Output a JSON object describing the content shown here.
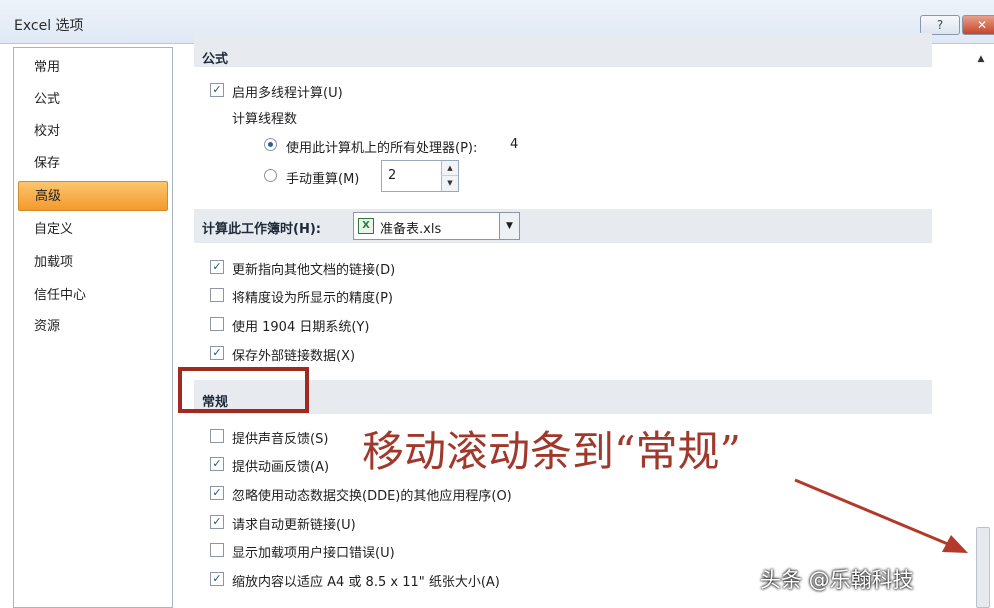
{
  "window": {
    "title": "Excel 选项",
    "help_label": "?",
    "close_label": "✕"
  },
  "sidebar": {
    "items": [
      {
        "label": "常用",
        "active": false
      },
      {
        "label": "公式",
        "active": false
      },
      {
        "label": "校对",
        "active": false
      },
      {
        "label": "保存",
        "active": false
      },
      {
        "label": "高级",
        "active": true
      },
      {
        "label": "自定义",
        "active": false
      },
      {
        "label": "加载项",
        "active": false
      },
      {
        "label": "信任中心",
        "active": false
      },
      {
        "label": "资源",
        "active": false
      }
    ]
  },
  "formulas": {
    "section_label": "公式",
    "multithread_label": "启用多线程计算(U)",
    "multithread_checked": true,
    "thread_count_label": "计算线程数",
    "use_all_label": "使用此计算机上的所有处理器(P):",
    "use_all_value": "4",
    "use_all_selected": true,
    "manual_label": "手动重算(M)",
    "manual_value": "2",
    "manual_selected": false
  },
  "workbook": {
    "section_label": "计算此工作簿时(H):",
    "selected_file": "准备表.xls",
    "options": [
      {
        "label": "更新指向其他文档的链接(D)",
        "checked": true
      },
      {
        "label": "将精度设为所显示的精度(P)",
        "checked": false
      },
      {
        "label": "使用 1904 日期系统(Y)",
        "checked": false
      },
      {
        "label": "保存外部链接数据(X)",
        "checked": true
      }
    ]
  },
  "general": {
    "section_label": "常规",
    "options": [
      {
        "label": "提供声音反馈(S)",
        "checked": false
      },
      {
        "label": "提供动画反馈(A)",
        "checked": true
      },
      {
        "label": "忽略使用动态数据交换(DDE)的其他应用程序(O)",
        "checked": true
      },
      {
        "label": "请求自动更新链接(U)",
        "checked": true
      },
      {
        "label": "显示加载项用户接口错误(U)",
        "checked": false
      },
      {
        "label": "缩放内容以适应 A4 或 8.5 x 11\" 纸张大小(A)",
        "checked": true
      }
    ]
  },
  "annotation": {
    "text": "移动滚动条到“常规”",
    "color": "#a0392c"
  },
  "watermark": {
    "text": "头条 @乐翰科技"
  }
}
